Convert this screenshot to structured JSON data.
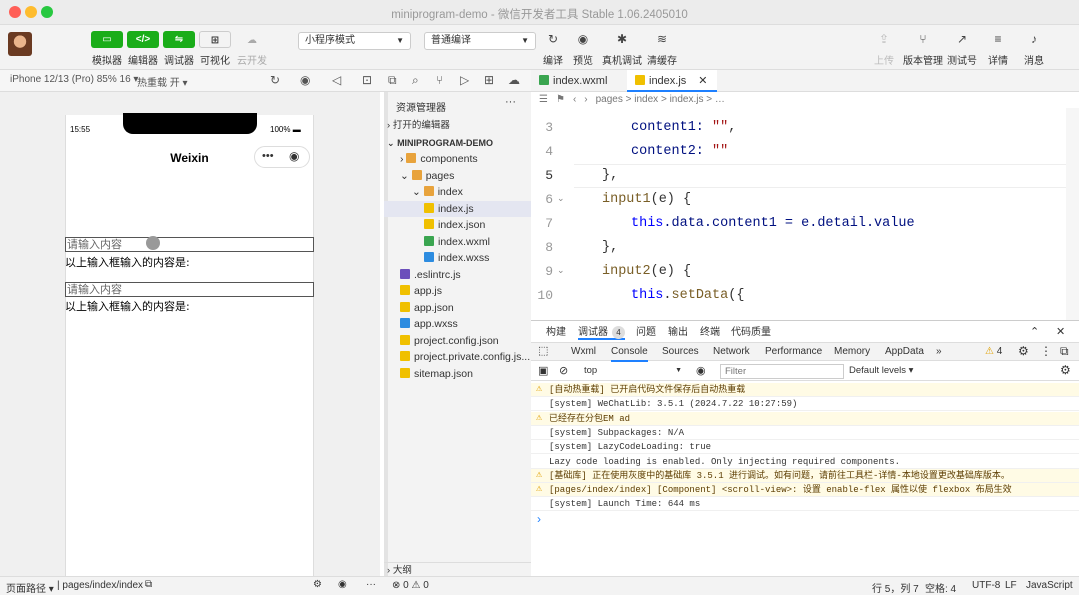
{
  "window": {
    "title": "miniprogram-demo - 微信开发者工具 Stable 1.06.2405010"
  },
  "toolbar": {
    "left_buttons": [
      {
        "icon": "phone-icon",
        "label": "模拟器"
      },
      {
        "icon": "code-icon",
        "label": "编辑器"
      },
      {
        "icon": "debug-icon",
        "label": "调试器"
      },
      {
        "icon": "layout-icon",
        "label": "可视化"
      },
      {
        "icon": "cloud-icon",
        "label": "云开发"
      }
    ],
    "mode_select": "小程序模式",
    "compile_select": "普通编译",
    "mid_buttons": [
      {
        "icon": "refresh-icon",
        "label": "编译",
        "glyph": "↻"
      },
      {
        "icon": "eye-icon",
        "label": "预览",
        "glyph": "◉"
      },
      {
        "icon": "bug-icon",
        "label": "真机调试",
        "glyph": "✱"
      },
      {
        "icon": "layers-icon",
        "label": "清缓存",
        "glyph": "≋"
      }
    ],
    "right_buttons": [
      {
        "icon": "upload-icon",
        "label": "上传",
        "glyph": "⇪"
      },
      {
        "icon": "branch-icon",
        "label": "版本管理",
        "glyph": "⑂"
      },
      {
        "icon": "test-icon",
        "label": "测试号",
        "glyph": "↗"
      },
      {
        "icon": "menu-icon",
        "label": "详情",
        "glyph": "≡"
      },
      {
        "icon": "bell-icon",
        "label": "消息",
        "glyph": "♪"
      }
    ]
  },
  "simulator": {
    "device": "iPhone 12/13 (Pro) 85% 16 ▾",
    "hot_reload": "热重载 开 ▾",
    "time": "15:55",
    "battery": "100%",
    "nav_title": "Weixin",
    "input1_placeholder": "请输入内容",
    "label1": "以上输入框输入的内容是:",
    "input2_placeholder": "请输入内容",
    "label2": "以上输入框输入的内容是:"
  },
  "explorer": {
    "title": "资源管理器",
    "open_editors": "打开的编辑器",
    "project": "MINIPROGRAM-DEMO",
    "outline": "大纲",
    "errors": "⊗ 0 ⚠ 0",
    "items": [
      {
        "name": "components",
        "type": "folder",
        "indent": 1
      },
      {
        "name": "pages",
        "type": "folder",
        "indent": 1
      },
      {
        "name": "index",
        "type": "folder",
        "indent": 2
      },
      {
        "name": "index.js",
        "type": "js",
        "indent": 3,
        "active": true
      },
      {
        "name": "index.json",
        "type": "json",
        "indent": 3
      },
      {
        "name": "index.wxml",
        "type": "wxml",
        "indent": 3
      },
      {
        "name": "index.wxss",
        "type": "wxss",
        "indent": 3
      },
      {
        "name": ".eslintrc.js",
        "type": "eslint",
        "indent": 1
      },
      {
        "name": "app.js",
        "type": "js",
        "indent": 1
      },
      {
        "name": "app.json",
        "type": "json",
        "indent": 1
      },
      {
        "name": "app.wxss",
        "type": "wxss",
        "indent": 1
      },
      {
        "name": "project.config.json",
        "type": "json",
        "indent": 1
      },
      {
        "name": "project.private.config.js...",
        "type": "json",
        "indent": 1
      },
      {
        "name": "sitemap.json",
        "type": "json",
        "indent": 1
      }
    ]
  },
  "editor": {
    "tabs": [
      {
        "name": "index.wxml"
      },
      {
        "name": "index.js",
        "active": true
      }
    ],
    "breadcrumb": "pages  >  index  >  index.js  >  …",
    "lines": [
      {
        "n": "3",
        "indent": 1,
        "parts": [
          {
            "t": "content1: ",
            "c": "pr"
          },
          {
            "t": "\"\"",
            "c": "st"
          },
          {
            "t": ",",
            "c": ""
          }
        ]
      },
      {
        "n": "4",
        "indent": 1,
        "parts": [
          {
            "t": "content2: ",
            "c": "pr"
          },
          {
            "t": "\"\"",
            "c": "st"
          }
        ]
      },
      {
        "n": "5",
        "indent": 0,
        "parts": [
          {
            "t": "},",
            "c": ""
          }
        ]
      },
      {
        "n": "6",
        "indent": 0,
        "parts": [
          {
            "t": "input1",
            "c": "fn"
          },
          {
            "t": "(e) {",
            "c": ""
          }
        ]
      },
      {
        "n": "7",
        "indent": 1,
        "parts": [
          {
            "t": "this",
            "c": "kw"
          },
          {
            "t": ".data.content1 = e.detail.value",
            "c": "pr"
          }
        ]
      },
      {
        "n": "8",
        "indent": 0,
        "parts": [
          {
            "t": "},",
            "c": ""
          }
        ]
      },
      {
        "n": "9",
        "indent": 0,
        "parts": [
          {
            "t": "input2",
            "c": "fn"
          },
          {
            "t": "(e) {",
            "c": ""
          }
        ]
      },
      {
        "n": "10",
        "indent": 1,
        "parts": [
          {
            "t": "this",
            "c": "kw"
          },
          {
            "t": ".",
            "c": ""
          },
          {
            "t": "setData",
            "c": "fn"
          },
          {
            "t": "({",
            "c": ""
          }
        ]
      }
    ]
  },
  "devtools": {
    "top_tabs": [
      "构建",
      "调试器",
      "问题",
      "输出",
      "终端",
      "代码质量"
    ],
    "debugger_badge": "4",
    "panel_tabs": [
      "Wxml",
      "Console",
      "Sources",
      "Network",
      "Performance",
      "Memory",
      "AppData",
      "»"
    ],
    "active_panel": "Console",
    "warn_count": "4",
    "context": "top",
    "filter_placeholder": "Filter",
    "levels": "Default levels ▾",
    "logs": [
      {
        "level": "warn",
        "text": "[自动热重载] 已开启代码文件保存后自动热重载"
      },
      {
        "level": "info",
        "text": "[system] WeChatLib: 3.5.1 (2024.7.22 10:27:59)"
      },
      {
        "level": "warn",
        "text": "已经存在分包EM ad"
      },
      {
        "level": "info",
        "text": "[system] Subpackages: N/A"
      },
      {
        "level": "info",
        "text": "[system] LazyCodeLoading: true"
      },
      {
        "level": "info",
        "text": "Lazy code loading is enabled. Only injecting required components."
      },
      {
        "level": "warn",
        "text": "[基础库] 正在使用灰度中的基础库 3.5.1 进行调试。如有问题，请前往工具栏-详情-本地设置更改基础库版本。"
      },
      {
        "level": "warn",
        "text": "[pages/index/index] [Component] <scroll-view>: 设置 enable-flex 属性以使 flexbox 布局生效"
      },
      {
        "level": "info",
        "text": "[system] Launch Time: 644 ms"
      }
    ],
    "prompt": "›"
  },
  "status": {
    "page_path_label": "页面路径 ▾",
    "page_path": "pages/index/index",
    "position": "行 5，列 7",
    "spaces": "空格: 4",
    "encoding": "UTF-8",
    "eol": "LF",
    "language": "JavaScript"
  }
}
